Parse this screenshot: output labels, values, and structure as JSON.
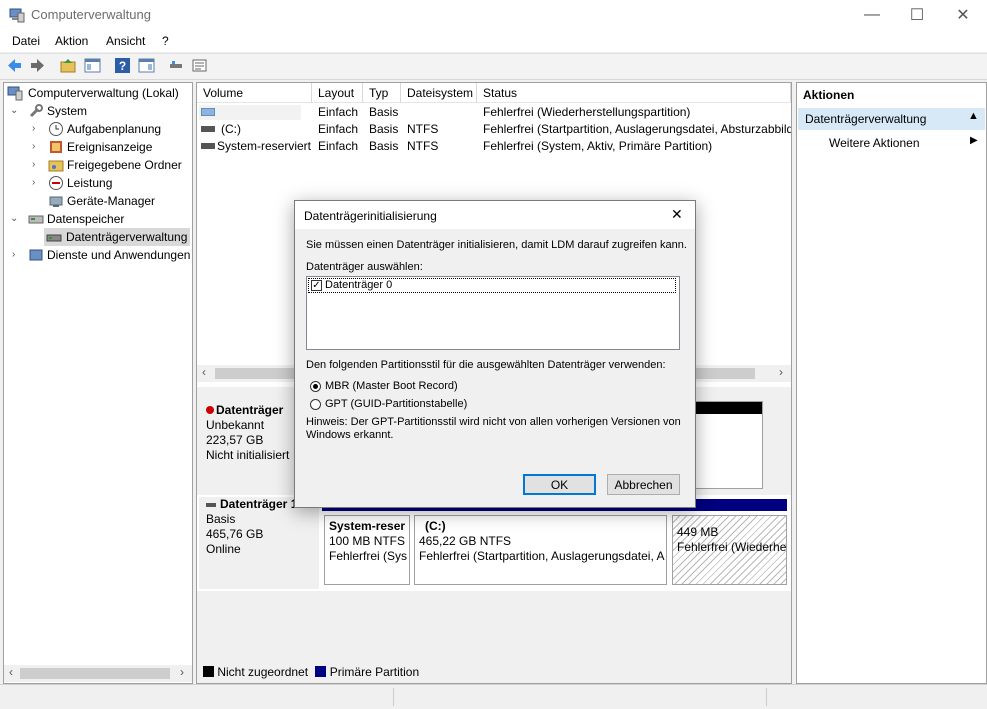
{
  "window": {
    "title": "Computerverwaltung",
    "minimize": "—",
    "maximize": "☐",
    "close": "✕"
  },
  "menu": [
    "Datei",
    "Aktion",
    "Ansicht",
    "?"
  ],
  "tree": {
    "root": "Computerverwaltung (Lokal)",
    "system": "System",
    "aufgabenplanung": "Aufgabenplanung",
    "ereignisanzeige": "Ereignisanzeige",
    "freigegebene": "Freigegebene Ordner",
    "leistung": "Leistung",
    "geraete": "Geräte-Manager",
    "datenspeicher": "Datenspeicher",
    "datentraegerverwaltung": "Datenträgerverwaltung",
    "dienste": "Dienste und Anwendungen"
  },
  "volumes": {
    "headers": [
      "Volume",
      "Layout",
      "Typ",
      "Dateisystem",
      "Status"
    ],
    "rows": [
      {
        "volume": "",
        "layout": "Einfach",
        "typ": "Basis",
        "fs": "",
        "status": "Fehlerfrei (Wiederherstellungspartition)"
      },
      {
        "volume": "(C:)",
        "layout": "Einfach",
        "typ": "Basis",
        "fs": "NTFS",
        "status": "Fehlerfrei (Startpartition, Auslagerungsdatei, Absturzabbild"
      },
      {
        "volume": "System-reserviert",
        "layout": "Einfach",
        "typ": "Basis",
        "fs": "NTFS",
        "status": "Fehlerfrei (System, Aktiv, Primäre Partition)"
      }
    ]
  },
  "disk0": {
    "name": "Datenträger",
    "type": "Unbekannt",
    "size": "223,57 GB",
    "state": "Nicht initialisiert"
  },
  "disk1": {
    "name": "Datenträger 1",
    "type": "Basis",
    "size": "465,76 GB",
    "state": "Online",
    "partitions": [
      {
        "name": "System-reser",
        "size": "100 MB NTFS",
        "status": "Fehlerfrei (Sys"
      },
      {
        "name": "(C:)",
        "size": "465,22 GB NTFS",
        "status": "Fehlerfrei (Startpartition, Auslagerungsdatei, A"
      },
      {
        "name": "",
        "size": "449 MB",
        "status": "Fehlerfrei (Wiederhe"
      }
    ]
  },
  "legend": {
    "unallocated": "Nicht zugeordnet",
    "primary": "Primäre Partition",
    "unallocated_color": "#000000",
    "primary_color": "#000080"
  },
  "actions": {
    "header": "Aktionen",
    "section": "Datenträgerverwaltung",
    "more": "Weitere Aktionen"
  },
  "dialog": {
    "title": "Datenträgerinitialisierung",
    "intro": "Sie müssen einen Datenträger initialisieren, damit LDM darauf zugreifen kann.",
    "select_label": "Datenträger auswählen:",
    "disk_item": "Datenträger 0",
    "style_label": "Den folgenden Partitionsstil für die ausgewählten Datenträger verwenden:",
    "mbr": "MBR (Master Boot Record)",
    "gpt": "GPT (GUID-Partitionstabelle)",
    "hint": "Hinweis: Der GPT-Partitionsstil wird nicht von allen vorherigen Versionen von",
    "hint2": "Windows erkannt.",
    "ok": "OK",
    "cancel": "Abbrechen"
  },
  "colors": {
    "selection": "#cce8ff",
    "accent": "#0078d7",
    "partition_bar": "#000080"
  }
}
